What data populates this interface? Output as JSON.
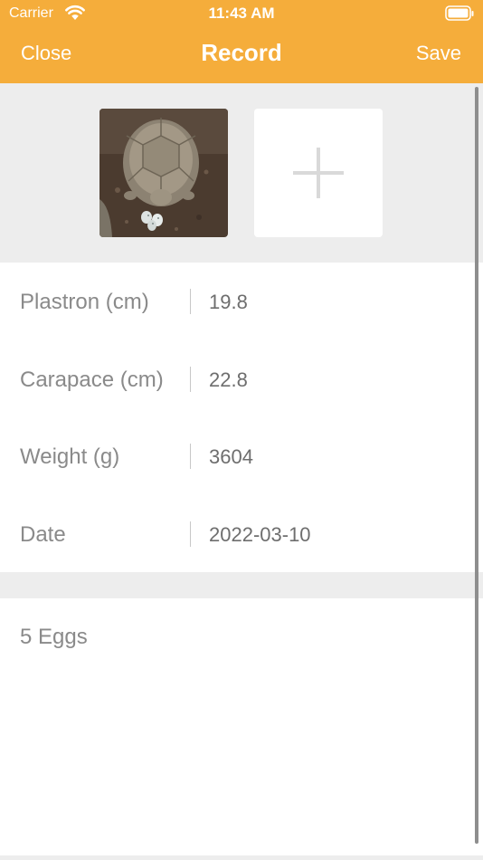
{
  "status_bar": {
    "carrier": "Carrier",
    "time": "11:43 AM"
  },
  "nav": {
    "close_label": "Close",
    "title": "Record",
    "save_label": "Save"
  },
  "colors": {
    "header": "#F5AD3B",
    "section_bg": "#EDEDED",
    "label_text": "#8A8A8A",
    "value_text": "#6E6E6E"
  },
  "fields": [
    {
      "label": "Plastron (cm)",
      "value": "19.8"
    },
    {
      "label": "Carapace (cm)",
      "value": "22.8"
    },
    {
      "label": "Weight (g)",
      "value": "3604"
    },
    {
      "label": "Date",
      "value": "2022-03-10"
    }
  ],
  "notes": "5 Eggs"
}
